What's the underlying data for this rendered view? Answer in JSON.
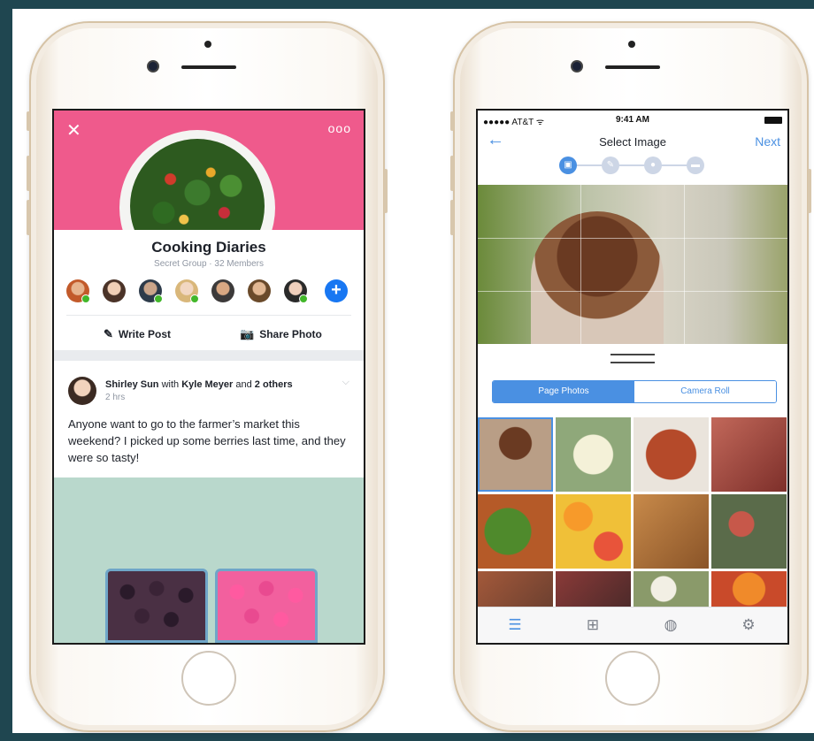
{
  "left_phone": {
    "group": {
      "name": "Cooking Diaries",
      "subtitle": "Secret Group · 32 Members",
      "close_glyph": "✕",
      "more_glyph": "ooo",
      "add_glyph": "+"
    },
    "actions": {
      "write_post": "Write Post",
      "share_photo": "Share Photo"
    },
    "post": {
      "author": "Shirley Sun",
      "with_word": "with",
      "tagged": "Kyle Meyer",
      "and_word": "and",
      "others": "2 others",
      "time": "2 hrs",
      "text": "Anyone want to go to the farmer’s market this weekend? I picked up some berries last time, and they were so tasty!"
    }
  },
  "right_phone": {
    "status_bar": {
      "carrier": "●●●●● AT&T ᯤ",
      "time": "9:41 AM"
    },
    "nav": {
      "title": "Select Image",
      "next": "Next",
      "back_glyph": "←"
    },
    "segmented": {
      "selected": "Page Photos",
      "other": "Camera Roll"
    },
    "tabbar_icons": [
      "list-icon",
      "add-icon",
      "globe-icon",
      "gear-icon"
    ],
    "tab_glyphs": [
      "☰",
      "⊞",
      "◍",
      "⚙"
    ]
  },
  "colors": {
    "accent_blue": "#4a90e2",
    "facebook_blue": "#1877f2",
    "cover_pink": "#ef5a8c",
    "online_green": "#42b72a"
  }
}
